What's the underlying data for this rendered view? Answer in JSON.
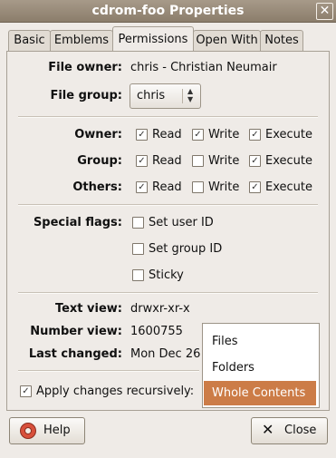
{
  "window": {
    "title": "cdrom-foo Properties",
    "close_glyph": "✕"
  },
  "tabs": [
    {
      "label": "Basic"
    },
    {
      "label": "Emblems"
    },
    {
      "label": "Permissions"
    },
    {
      "label": "Open With"
    },
    {
      "label": "Notes"
    }
  ],
  "owner": {
    "label": "File owner:",
    "value": "chris - Christian Neumair"
  },
  "group": {
    "label": "File group:",
    "value": "chris"
  },
  "permissions": {
    "owner": {
      "label": "Owner:",
      "read": true,
      "write": true,
      "execute": true
    },
    "group": {
      "label": "Group:",
      "read": true,
      "write": false,
      "execute": true
    },
    "others": {
      "label": "Others:",
      "read": true,
      "write": false,
      "execute": true
    },
    "read_label": "Read",
    "write_label": "Write",
    "execute_label": "Execute"
  },
  "special_flags": {
    "label": "Special flags:",
    "set_uid": "Set user ID",
    "set_gid": "Set group ID",
    "sticky": "Sticky"
  },
  "views": {
    "text_label": "Text view:",
    "text_value": "drwxr-xr-x",
    "number_label": "Number view:",
    "number_value": "1600755",
    "changed_label": "Last changed:",
    "changed_value": "Mon Dec 26"
  },
  "apply": {
    "label": "Apply changes recursively:",
    "checked": true
  },
  "recursive_menu": {
    "items": [
      "Files",
      "Folders",
      "Whole Contents"
    ],
    "selected": "Whole Contents"
  },
  "buttons": {
    "help": "Help",
    "close": "Close"
  },
  "colors": {
    "selection": "#cc7c47",
    "titlebar": "#9b8c79"
  }
}
